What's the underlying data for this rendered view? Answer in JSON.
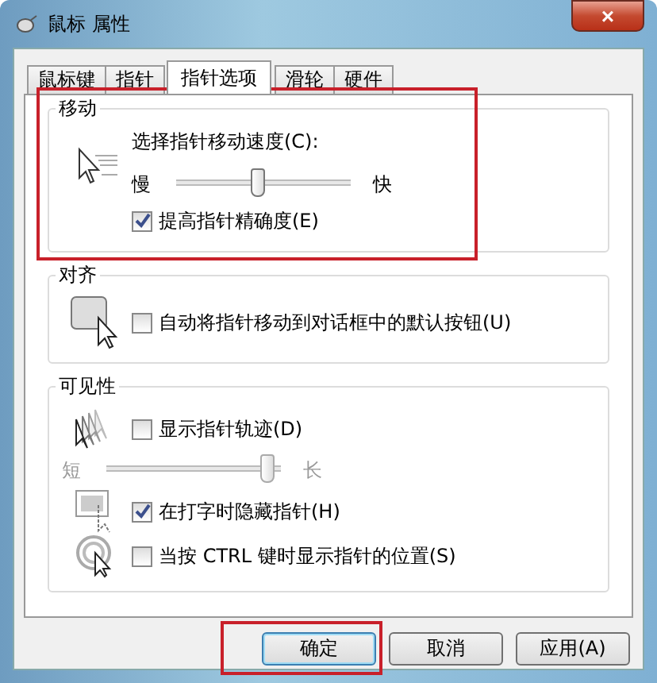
{
  "window": {
    "title": "鼠标 属性",
    "close": "×"
  },
  "tabs": [
    {
      "label": "鼠标键",
      "selected": false
    },
    {
      "label": "指针",
      "selected": false
    },
    {
      "label": "指针选项",
      "selected": true
    },
    {
      "label": "滑轮",
      "selected": false
    },
    {
      "label": "硬件",
      "selected": false
    }
  ],
  "groups": [
    {
      "title": "移动",
      "highlighted": true,
      "rows": [
        {
          "kind": "slider",
          "label": "选择指针移动速度(C):",
          "min_label": "慢",
          "max_label": "快",
          "level": 0.5,
          "disabled": false
        },
        {
          "kind": "checkbox",
          "label": "提高指针精确度(E)",
          "checked": true
        }
      ]
    },
    {
      "title": "对齐",
      "highlighted": false,
      "rows": [
        {
          "kind": "checkbox",
          "label": "自动将指针移动到对话框中的默认按钮(U)",
          "checked": false
        }
      ]
    },
    {
      "title": "可见性",
      "highlighted": false,
      "rows": [
        {
          "kind": "checkbox",
          "label": "显示指针轨迹(D)",
          "checked": false
        },
        {
          "kind": "slider",
          "min_label": "短",
          "max_label": "长",
          "level": 1,
          "disabled": true
        },
        {
          "kind": "checkbox",
          "label": "在打字时隐藏指针(H)",
          "checked": true
        },
        {
          "kind": "checkbox",
          "label": "当按 CTRL 键时显示指针的位置(S)",
          "checked": false
        }
      ]
    }
  ],
  "buttons": [
    {
      "label": "确定",
      "highlighted": true
    },
    {
      "label": "取消",
      "highlighted": false
    },
    {
      "label": "应用(A)",
      "highlighted": false
    }
  ]
}
